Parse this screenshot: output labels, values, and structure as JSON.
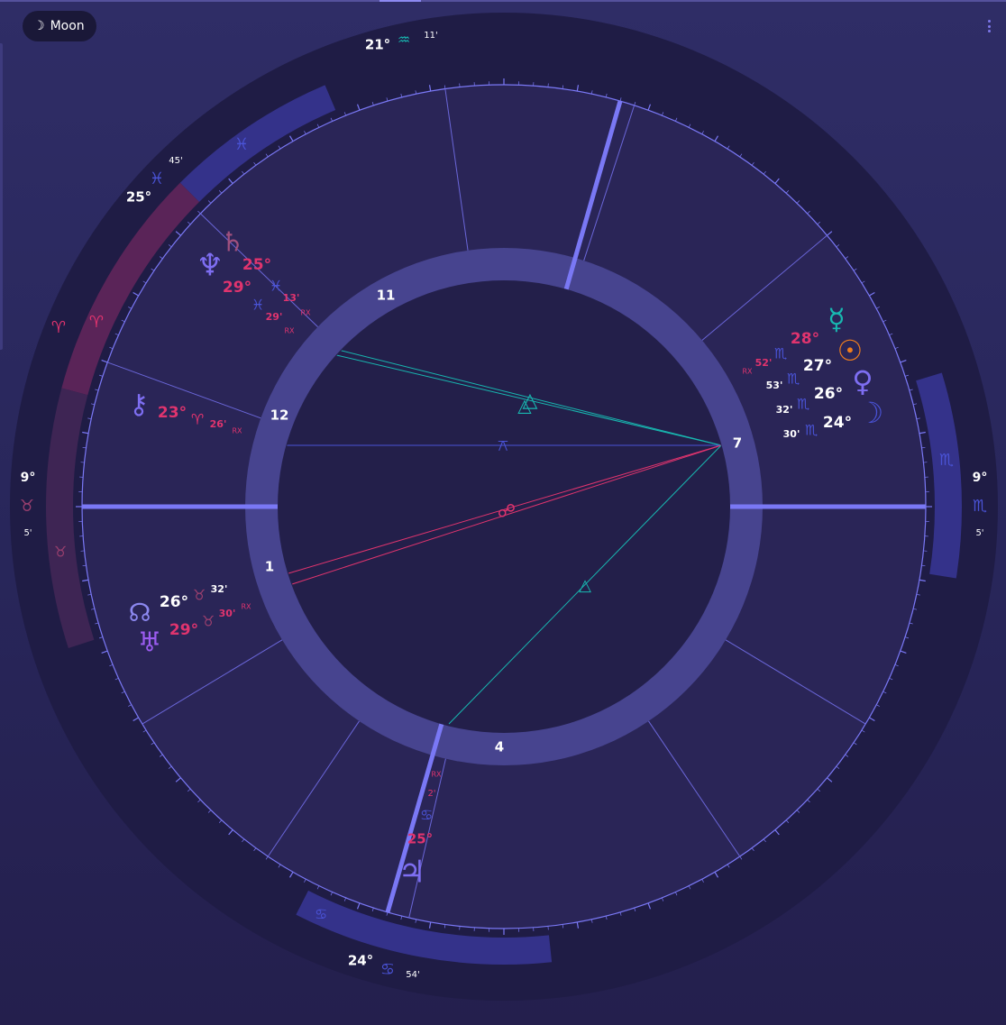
{
  "toolbar": {
    "moon_label": "Moon",
    "moon_icon": "crescent-moon-icon",
    "menu_icon": "kebab-menu-icon"
  },
  "colors": {
    "background": "#2d2b63",
    "outer_ring": "#1f1c45",
    "house_ring": "#2a2557",
    "inner_ring": "#47448f",
    "center": "#231f4a",
    "axis": "#7a78f5",
    "pink": "#e0346e",
    "teal": "#18b7b0",
    "orange": "#ee7d1e",
    "purple": "#7e6ef2",
    "blue": "#4a53d6",
    "white": "#ffffff"
  },
  "signs": {
    "aquarius": "♒",
    "pisces": "♓",
    "aries": "♈",
    "taurus": "♉",
    "cancer": "♋",
    "scorpio": "♏"
  },
  "house_numbers": [
    "11",
    "12",
    "1",
    "4",
    "7"
  ],
  "cusps": {
    "mc": {
      "deg": "21°",
      "sign": "♒",
      "min": "11'"
    },
    "ac": {
      "deg": "9°",
      "sign": "♉",
      "min": "5'"
    },
    "ic": {
      "deg": "24°",
      "sign": "♋",
      "min": "54'"
    },
    "dc": {
      "deg": "9°",
      "sign": "♏",
      "min": "5'"
    },
    "h12": {
      "deg": "25°",
      "sign": "♓",
      "min": "45'"
    }
  },
  "planets": [
    {
      "id": "saturn",
      "glyph": "♄",
      "deg": "25°",
      "sign": "♓",
      "min": "13'",
      "rx": "RX"
    },
    {
      "id": "neptune",
      "glyph": "♆",
      "deg": "29°",
      "sign": "♓",
      "min": "29'",
      "rx": "RX"
    },
    {
      "id": "chiron",
      "glyph": "⚷",
      "deg": "23°",
      "sign": "♈",
      "min": "26'",
      "rx": "RX"
    },
    {
      "id": "node",
      "glyph": "☊",
      "deg": "26°",
      "sign": "♉",
      "min": "32'",
      "rx": ""
    },
    {
      "id": "uranus",
      "glyph": "♅",
      "deg": "29°",
      "sign": "♉",
      "min": "30'",
      "rx": "RX"
    },
    {
      "id": "mercury",
      "glyph": "☿",
      "deg": "28°",
      "sign": "♏",
      "min": "52'",
      "rx": "RX"
    },
    {
      "id": "sun",
      "glyph": "☉",
      "deg": "27°",
      "sign": "♏",
      "min": "53'",
      "rx": ""
    },
    {
      "id": "venus",
      "glyph": "♀",
      "deg": "26°",
      "sign": "♏",
      "min": "32'",
      "rx": ""
    },
    {
      "id": "moon",
      "glyph": "☽",
      "deg": "24°",
      "sign": "♏",
      "min": "30'",
      "rx": ""
    },
    {
      "id": "jupiter",
      "glyph": "♃",
      "deg": "25°",
      "sign": "♋",
      "min": "2'",
      "rx": "RX"
    }
  ],
  "aspect_symbols": {
    "trine": "△",
    "quincunx": "⚻",
    "opposition": "☍"
  }
}
